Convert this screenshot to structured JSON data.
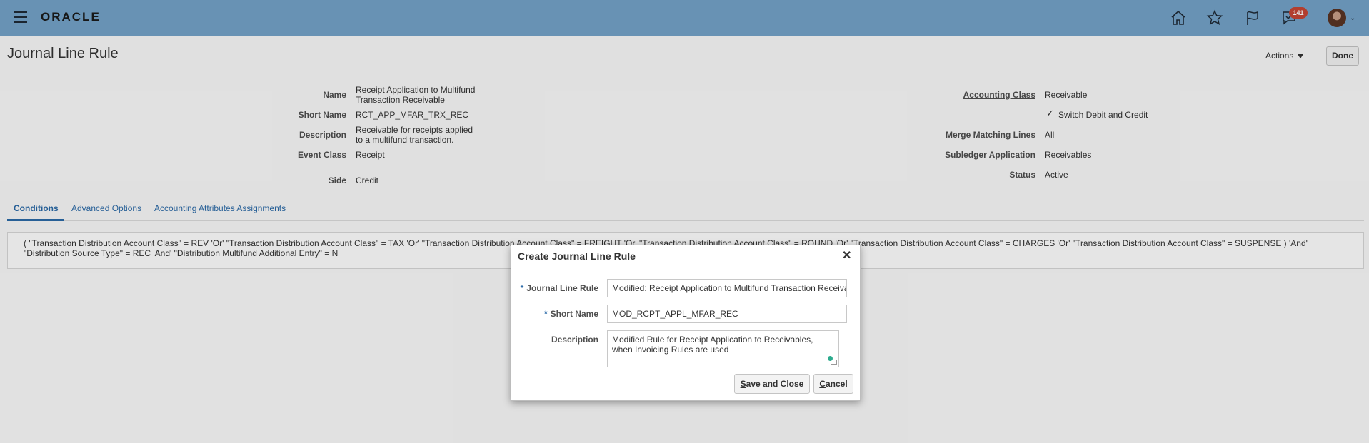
{
  "header": {
    "logo": "ORACLE",
    "notifications_count": "141",
    "icons": [
      "menu-icon",
      "home-icon",
      "star-icon",
      "flag-icon",
      "bell-icon",
      "avatar"
    ]
  },
  "page": {
    "title": "Journal Line Rule",
    "actions_label": "Actions",
    "done_label": "Done"
  },
  "details": {
    "name_label": "Name",
    "name_line1": "Receipt Application to Multifund",
    "name_line2": "Transaction Receivable",
    "short_name_label": "Short Name",
    "short_name": "RCT_APP_MFAR_TRX_REC",
    "description_label": "Description",
    "description_line1": "Receivable for receipts applied",
    "description_line2": "to a multifund transaction.",
    "event_class_label": "Event Class",
    "event_class": "Receipt",
    "side_label": "Side",
    "side": "Credit",
    "accounting_class_label": "Accounting Class",
    "accounting_class": "Receivable",
    "switch_debit_credit": "Switch Debit and Credit",
    "merge_matching_lines_label": "Merge Matching Lines",
    "merge_matching_lines": "All",
    "subledger_application_label": "Subledger Application",
    "subledger_application": "Receivables",
    "status_label": "Status",
    "status": "Active"
  },
  "tabs": {
    "conditions": "Conditions",
    "advanced_options": "Advanced Options",
    "accounting_attributes": "Accounting Attributes Assignments"
  },
  "condition": {
    "line1": "( \"Transaction Distribution Account Class\" = REV 'Or' \"Transaction Distribution Account Class\" = TAX 'Or' \"Transaction Distribution Account Class\" = FREIGHT 'Or' \"Transaction Distribution Account Class\" = ROUND 'Or' \"Transaction Distribution Account Class\" = CHARGES 'Or' \"Transaction Distribution Account Class\" = SUSPENSE ) 'And'",
    "line2": "\"Distribution Source Type\" = REC 'And' \"Distribution Multifund Additional Entry\" = N"
  },
  "dialog": {
    "title": "Create Journal Line Rule",
    "journal_line_rule_label": "Journal Line Rule",
    "journal_line_rule_value": "Modified: Receipt Application to Multifund Transaction Receivable",
    "short_name_label": "Short Name",
    "short_name_value": "MOD_RCPT_APPL_MFAR_REC",
    "description_label": "Description",
    "description_value": "Modified Rule for Receipt Application to Receivables, when Invoicing Rules are used",
    "save_close_first": "S",
    "save_close_rest": "ave and Close",
    "cancel_first": "C",
    "cancel_rest": "ancel",
    "required_mark": "*"
  }
}
